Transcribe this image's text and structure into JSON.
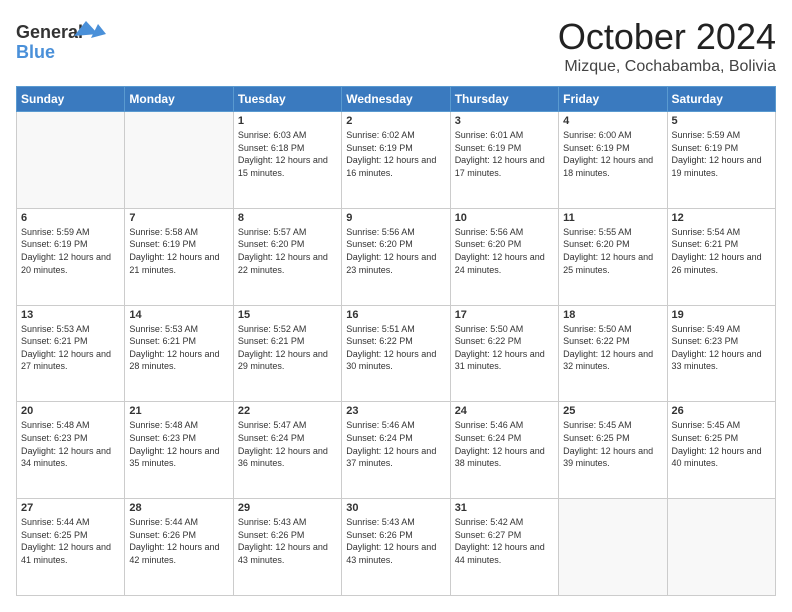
{
  "header": {
    "logo_general": "General",
    "logo_blue": "Blue",
    "month_title": "October 2024",
    "location": "Mizque, Cochabamba, Bolivia"
  },
  "days_of_week": [
    "Sunday",
    "Monday",
    "Tuesday",
    "Wednesday",
    "Thursday",
    "Friday",
    "Saturday"
  ],
  "weeks": [
    [
      {
        "day": "",
        "info": ""
      },
      {
        "day": "",
        "info": ""
      },
      {
        "day": "1",
        "info": "Sunrise: 6:03 AM\nSunset: 6:18 PM\nDaylight: 12 hours and 15 minutes."
      },
      {
        "day": "2",
        "info": "Sunrise: 6:02 AM\nSunset: 6:19 PM\nDaylight: 12 hours and 16 minutes."
      },
      {
        "day": "3",
        "info": "Sunrise: 6:01 AM\nSunset: 6:19 PM\nDaylight: 12 hours and 17 minutes."
      },
      {
        "day": "4",
        "info": "Sunrise: 6:00 AM\nSunset: 6:19 PM\nDaylight: 12 hours and 18 minutes."
      },
      {
        "day": "5",
        "info": "Sunrise: 5:59 AM\nSunset: 6:19 PM\nDaylight: 12 hours and 19 minutes."
      }
    ],
    [
      {
        "day": "6",
        "info": "Sunrise: 5:59 AM\nSunset: 6:19 PM\nDaylight: 12 hours and 20 minutes."
      },
      {
        "day": "7",
        "info": "Sunrise: 5:58 AM\nSunset: 6:19 PM\nDaylight: 12 hours and 21 minutes."
      },
      {
        "day": "8",
        "info": "Sunrise: 5:57 AM\nSunset: 6:20 PM\nDaylight: 12 hours and 22 minutes."
      },
      {
        "day": "9",
        "info": "Sunrise: 5:56 AM\nSunset: 6:20 PM\nDaylight: 12 hours and 23 minutes."
      },
      {
        "day": "10",
        "info": "Sunrise: 5:56 AM\nSunset: 6:20 PM\nDaylight: 12 hours and 24 minutes."
      },
      {
        "day": "11",
        "info": "Sunrise: 5:55 AM\nSunset: 6:20 PM\nDaylight: 12 hours and 25 minutes."
      },
      {
        "day": "12",
        "info": "Sunrise: 5:54 AM\nSunset: 6:21 PM\nDaylight: 12 hours and 26 minutes."
      }
    ],
    [
      {
        "day": "13",
        "info": "Sunrise: 5:53 AM\nSunset: 6:21 PM\nDaylight: 12 hours and 27 minutes."
      },
      {
        "day": "14",
        "info": "Sunrise: 5:53 AM\nSunset: 6:21 PM\nDaylight: 12 hours and 28 minutes."
      },
      {
        "day": "15",
        "info": "Sunrise: 5:52 AM\nSunset: 6:21 PM\nDaylight: 12 hours and 29 minutes."
      },
      {
        "day": "16",
        "info": "Sunrise: 5:51 AM\nSunset: 6:22 PM\nDaylight: 12 hours and 30 minutes."
      },
      {
        "day": "17",
        "info": "Sunrise: 5:50 AM\nSunset: 6:22 PM\nDaylight: 12 hours and 31 minutes."
      },
      {
        "day": "18",
        "info": "Sunrise: 5:50 AM\nSunset: 6:22 PM\nDaylight: 12 hours and 32 minutes."
      },
      {
        "day": "19",
        "info": "Sunrise: 5:49 AM\nSunset: 6:23 PM\nDaylight: 12 hours and 33 minutes."
      }
    ],
    [
      {
        "day": "20",
        "info": "Sunrise: 5:48 AM\nSunset: 6:23 PM\nDaylight: 12 hours and 34 minutes."
      },
      {
        "day": "21",
        "info": "Sunrise: 5:48 AM\nSunset: 6:23 PM\nDaylight: 12 hours and 35 minutes."
      },
      {
        "day": "22",
        "info": "Sunrise: 5:47 AM\nSunset: 6:24 PM\nDaylight: 12 hours and 36 minutes."
      },
      {
        "day": "23",
        "info": "Sunrise: 5:46 AM\nSunset: 6:24 PM\nDaylight: 12 hours and 37 minutes."
      },
      {
        "day": "24",
        "info": "Sunrise: 5:46 AM\nSunset: 6:24 PM\nDaylight: 12 hours and 38 minutes."
      },
      {
        "day": "25",
        "info": "Sunrise: 5:45 AM\nSunset: 6:25 PM\nDaylight: 12 hours and 39 minutes."
      },
      {
        "day": "26",
        "info": "Sunrise: 5:45 AM\nSunset: 6:25 PM\nDaylight: 12 hours and 40 minutes."
      }
    ],
    [
      {
        "day": "27",
        "info": "Sunrise: 5:44 AM\nSunset: 6:25 PM\nDaylight: 12 hours and 41 minutes."
      },
      {
        "day": "28",
        "info": "Sunrise: 5:44 AM\nSunset: 6:26 PM\nDaylight: 12 hours and 42 minutes."
      },
      {
        "day": "29",
        "info": "Sunrise: 5:43 AM\nSunset: 6:26 PM\nDaylight: 12 hours and 43 minutes."
      },
      {
        "day": "30",
        "info": "Sunrise: 5:43 AM\nSunset: 6:26 PM\nDaylight: 12 hours and 43 minutes."
      },
      {
        "day": "31",
        "info": "Sunrise: 5:42 AM\nSunset: 6:27 PM\nDaylight: 12 hours and 44 minutes."
      },
      {
        "day": "",
        "info": ""
      },
      {
        "day": "",
        "info": ""
      }
    ]
  ]
}
